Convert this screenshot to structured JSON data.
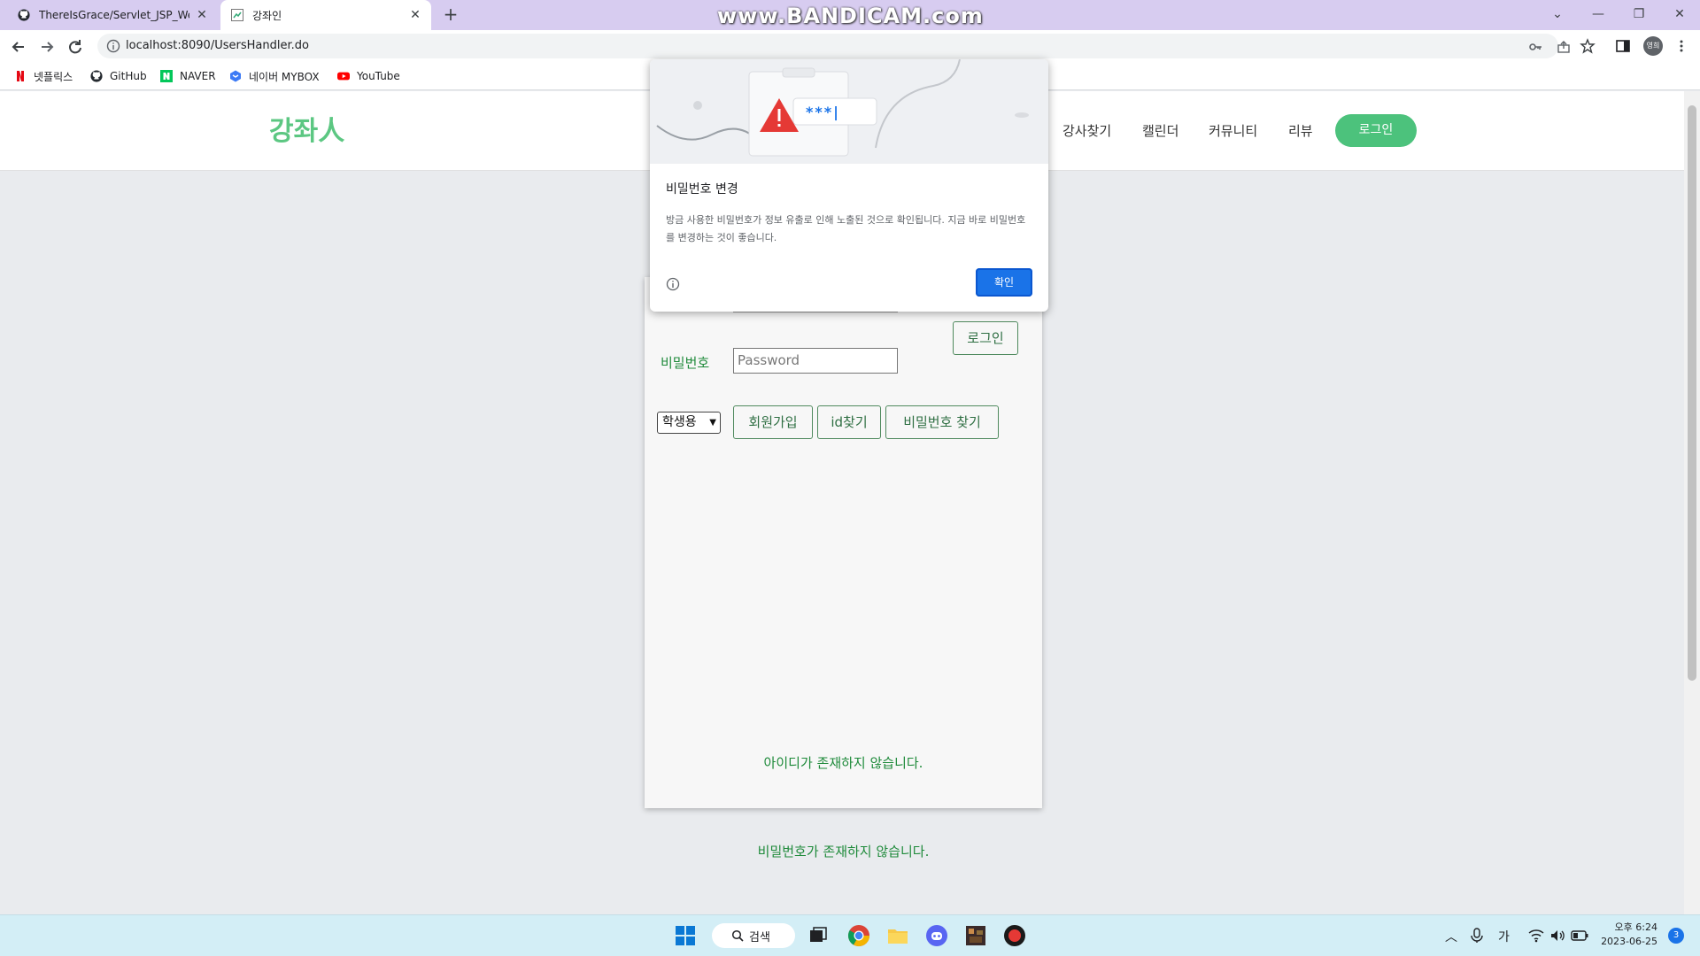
{
  "browser": {
    "tabs": [
      {
        "title": "ThereIsGrace/Servlet_JSP_WebS"
      },
      {
        "title": "강좌인"
      }
    ],
    "url": "localhost:8090/UsersHandler.do",
    "bookmarks": [
      "넷플릭스",
      "GitHub",
      "NAVER",
      "네이버 MYBOX",
      "YouTube"
    ],
    "profile_initials": "영희"
  },
  "recorder_watermark": "www.BANDICAM.com",
  "site": {
    "logo": "강좌人",
    "nav": [
      "강사찾기",
      "캘린더",
      "커뮤니티",
      "리뷰"
    ],
    "nav_login": "로그인"
  },
  "login_form": {
    "login_button": "로그인",
    "password_label": "비밀번호",
    "password_placeholder": "Password",
    "role_selected": "학생용",
    "buttons": [
      "회원가입",
      "id찾기",
      "비밀번호 찾기"
    ],
    "id_error": "아이디가 존재하지 않습니다.",
    "password_error": "비밀번호가 존재하지 않습니다."
  },
  "password_dialog": {
    "illustration_text": "***|",
    "title": "비밀번호 변경",
    "body": "방금 사용한 비밀번호가 정보 유출로 인해 노출된 것으로 확인됩니다. 지금 바로 비밀번호를 변경하는 것이 좋습니다.",
    "ok_button": "확인"
  },
  "taskbar": {
    "search_label": "검색",
    "ime": "가",
    "clock_time": "오후 6:24",
    "clock_date": "2023-06-25",
    "notification_count": "3"
  },
  "colors": {
    "brand_green": "#5cc782",
    "nav_login_bg": "#4cc27c",
    "form_text_green": "#1e8a3a",
    "dialog_ok_blue": "#1a73e8",
    "titlebar": "#d7ccf0",
    "taskbar": "#d3eef6"
  }
}
